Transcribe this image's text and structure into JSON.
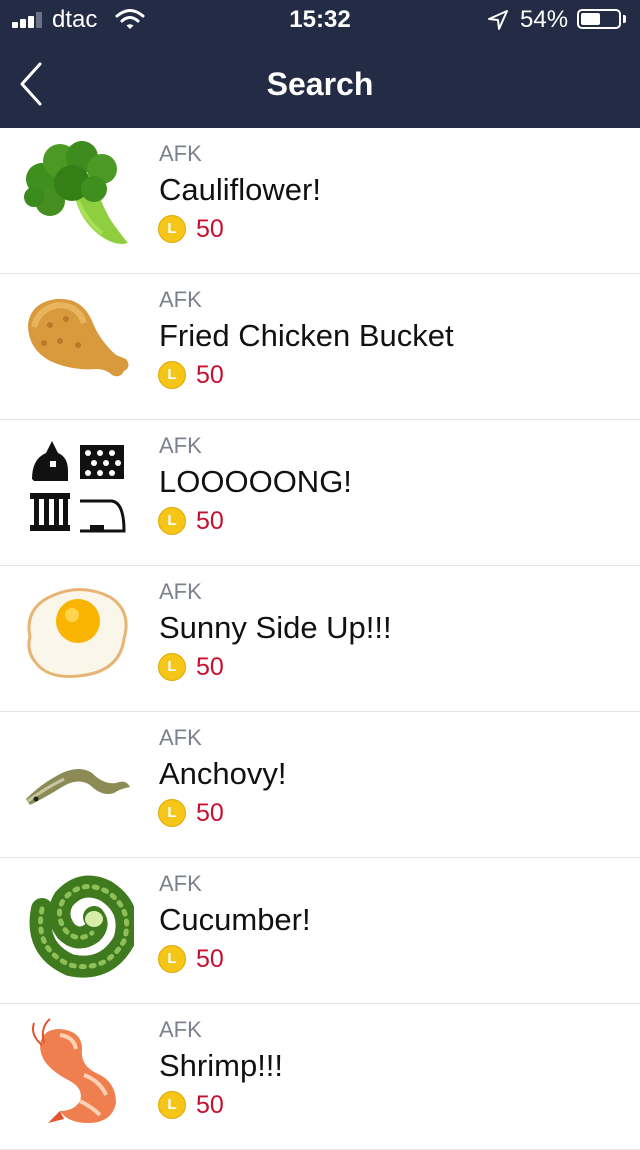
{
  "status_bar": {
    "carrier": "dtac",
    "time": "15:32",
    "battery_percent": "54%",
    "battery_level": 0.54,
    "signal_bars": 3,
    "signal_bars_total": 4
  },
  "nav": {
    "title": "Search",
    "back_icon": "chevron-left-icon"
  },
  "colors": {
    "header_bg": "#232b45",
    "price": "#c8102e",
    "coin": "#f5c518",
    "author": "#7d818c"
  },
  "coin_letter": "L",
  "items": [
    {
      "author": "AFK",
      "name": "Cauliflower!",
      "price": "50",
      "thumb": "broccoli"
    },
    {
      "author": "AFK",
      "name": "Fried Chicken Bucket",
      "price": "50",
      "thumb": "fried-chicken"
    },
    {
      "author": "AFK",
      "name": "LOOOOONG!",
      "price": "50",
      "thumb": "pixel-icons"
    },
    {
      "author": "AFK",
      "name": "Sunny Side Up!!!",
      "price": "50",
      "thumb": "fried-egg"
    },
    {
      "author": "AFK",
      "name": "Anchovy!",
      "price": "50",
      "thumb": "anchovy"
    },
    {
      "author": "AFK",
      "name": "Cucumber!",
      "price": "50",
      "thumb": "cucumber"
    },
    {
      "author": "AFK",
      "name": "Shrimp!!!",
      "price": "50",
      "thumb": "shrimp"
    }
  ]
}
